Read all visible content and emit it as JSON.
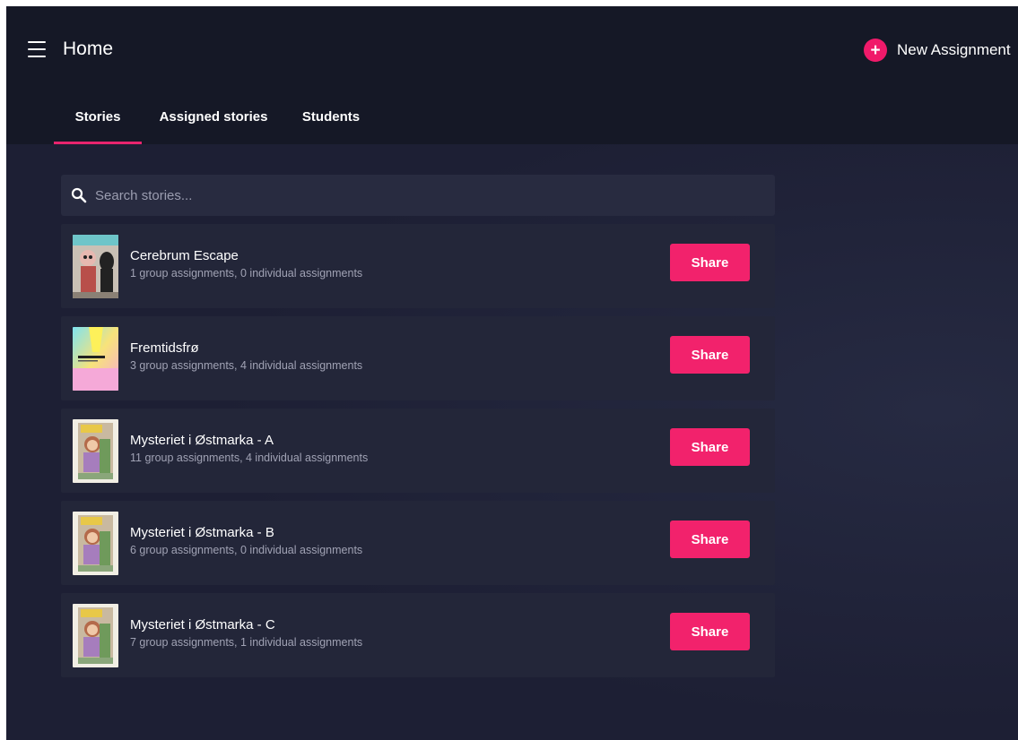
{
  "header": {
    "title": "Home",
    "new_assignment_label": "New Assignment",
    "accent_color": "#f2226c"
  },
  "tabs": [
    {
      "label": "Stories",
      "active": true
    },
    {
      "label": "Assigned stories",
      "active": false
    },
    {
      "label": "Students",
      "active": false
    }
  ],
  "search": {
    "placeholder": "Search stories...",
    "value": ""
  },
  "stories": [
    {
      "title": "Cerebrum Escape",
      "subtitle": "1 group assignments, 0 individual assignments",
      "share_label": "Share",
      "cover_icon": "cerebrum-escape-cover"
    },
    {
      "title": "Fremtidsfrø",
      "subtitle": "3 group assignments, 4 individual assignments",
      "share_label": "Share",
      "cover_icon": "fremtidsfro-cover"
    },
    {
      "title": "Mysteriet i Østmarka - A",
      "subtitle": "11 group assignments, 4 individual assignments",
      "share_label": "Share",
      "cover_icon": "mysteriet-cover"
    },
    {
      "title": "Mysteriet i Østmarka - B",
      "subtitle": "6 group assignments, 0 individual assignments",
      "share_label": "Share",
      "cover_icon": "mysteriet-cover"
    },
    {
      "title": "Mysteriet i Østmarka - C",
      "subtitle": "7 group assignments, 1 individual assignments",
      "share_label": "Share",
      "cover_icon": "mysteriet-cover"
    }
  ]
}
